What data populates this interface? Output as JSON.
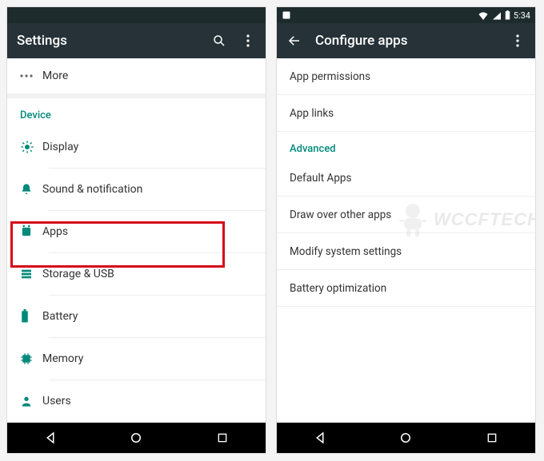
{
  "left": {
    "appbar_title": "Settings",
    "more_label": "More",
    "sections": {
      "device_title": "Device",
      "items": [
        {
          "id": "display",
          "label": "Display"
        },
        {
          "id": "sound",
          "label": "Sound & notification"
        },
        {
          "id": "apps",
          "label": "Apps"
        },
        {
          "id": "storage",
          "label": "Storage & USB"
        },
        {
          "id": "battery",
          "label": "Battery"
        },
        {
          "id": "memory",
          "label": "Memory"
        },
        {
          "id": "users",
          "label": "Users"
        }
      ]
    }
  },
  "right": {
    "status_time": "5:34",
    "appbar_title": "Configure apps",
    "items_top": [
      {
        "label": "App permissions"
      },
      {
        "label": "App links"
      }
    ],
    "section_title": "Advanced",
    "items_adv": [
      {
        "label": "Default Apps"
      },
      {
        "label": "Draw over other apps"
      },
      {
        "label": "Modify system settings"
      },
      {
        "label": "Battery optimization"
      }
    ]
  },
  "watermark_text": "WCCFTECH",
  "colors": {
    "accent": "#00897b",
    "appbar": "#263238",
    "highlight": "#d4071a"
  }
}
